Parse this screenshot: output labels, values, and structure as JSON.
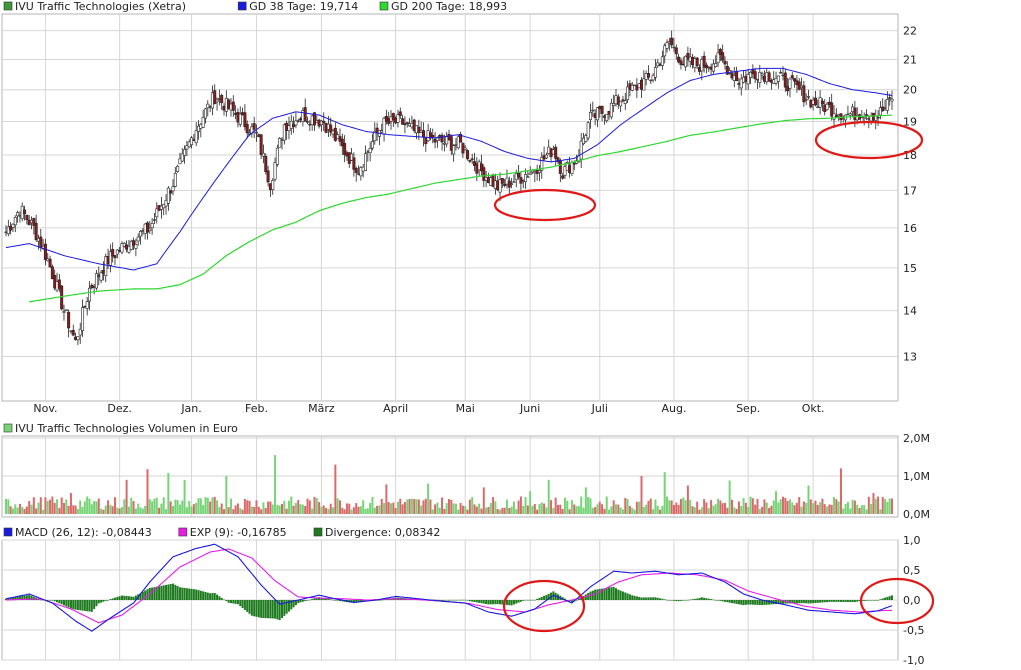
{
  "colors": {
    "grid": "#d6d6d6",
    "frame": "#b4b4b4",
    "candle_up": "#3c9a3c",
    "candle_down": "#8b1a1a",
    "gd38": "#1b1be0",
    "gd200": "#2ed82e",
    "macd": "#1b1be0",
    "exp": "#e81ee8",
    "divergence": "#1e7a1e",
    "vol_up": "#76d476",
    "vol_down": "#d86a6a",
    "highlight": "#e01818"
  },
  "chart_data": [
    {
      "type": "candlestick",
      "panel": "price",
      "legend": [
        {
          "label": "IVU Traffic Technologies (Xetra)",
          "color": "#3c9a3c"
        },
        {
          "label": "GD 38 Tage: 19,714",
          "color": "#1b1be0"
        },
        {
          "label": "GD 200 Tage: 18,993",
          "color": "#2ed82e"
        }
      ],
      "y_ticks": [
        "22",
        "21",
        "20",
        "19",
        "18",
        "17",
        "16",
        "15",
        "14",
        "13"
      ],
      "y_tick_values": [
        22,
        21,
        20,
        19,
        18,
        17,
        16,
        15,
        14,
        13
      ],
      "ylim": [
        12.1,
        22.6
      ],
      "scale": "log",
      "x_ticks": [
        "Nov.",
        "Dez.",
        "Jan.",
        "Feb.",
        "März",
        "April",
        "Mai",
        "Juni",
        "Juli",
        "Aug.",
        "Sep.",
        "Okt."
      ],
      "x_tick_index": [
        17,
        49,
        80,
        108,
        136,
        168,
        198,
        226,
        256,
        288,
        320,
        348
      ],
      "n_days": 383,
      "anchors_close": [
        [
          0,
          15.9
        ],
        [
          6,
          16.5
        ],
        [
          12,
          16.0
        ],
        [
          18,
          15.2
        ],
        [
          25,
          14.0
        ],
        [
          30,
          13.3
        ],
        [
          36,
          14.5
        ],
        [
          44,
          15.2
        ],
        [
          52,
          15.6
        ],
        [
          62,
          16.0
        ],
        [
          72,
          17.2
        ],
        [
          82,
          18.8
        ],
        [
          90,
          19.8
        ],
        [
          98,
          19.3
        ],
        [
          108,
          18.6
        ],
        [
          114,
          17.2
        ],
        [
          120,
          18.9
        ],
        [
          128,
          19.2
        ],
        [
          137,
          19.0
        ],
        [
          145,
          18.2
        ],
        [
          152,
          17.6
        ],
        [
          162,
          18.9
        ],
        [
          170,
          19.0
        ],
        [
          178,
          18.6
        ],
        [
          186,
          18.4
        ],
        [
          196,
          18.3
        ],
        [
          204,
          17.6
        ],
        [
          212,
          17.1
        ],
        [
          220,
          17.3
        ],
        [
          228,
          17.6
        ],
        [
          236,
          18.2
        ],
        [
          240,
          17.5
        ],
        [
          246,
          17.9
        ],
        [
          252,
          19.1
        ],
        [
          260,
          19.4
        ],
        [
          270,
          20.0
        ],
        [
          278,
          20.4
        ],
        [
          286,
          21.6
        ],
        [
          292,
          20.9
        ],
        [
          300,
          20.8
        ],
        [
          308,
          21.0
        ],
        [
          316,
          20.3
        ],
        [
          324,
          20.6
        ],
        [
          332,
          20.4
        ],
        [
          340,
          20.1
        ],
        [
          348,
          19.6
        ],
        [
          356,
          19.4
        ],
        [
          362,
          19.2
        ],
        [
          370,
          19.3
        ],
        [
          376,
          19.2
        ],
        [
          380,
          19.5
        ],
        [
          383,
          19.9
        ]
      ],
      "anchors_gd38": [
        [
          0,
          15.5
        ],
        [
          10,
          15.6
        ],
        [
          25,
          15.3
        ],
        [
          40,
          15.1
        ],
        [
          55,
          14.95
        ],
        [
          65,
          15.1
        ],
        [
          75,
          15.9
        ],
        [
          85,
          16.8
        ],
        [
          95,
          17.7
        ],
        [
          105,
          18.6
        ],
        [
          115,
          19.1
        ],
        [
          125,
          19.3
        ],
        [
          135,
          19.2
        ],
        [
          145,
          18.9
        ],
        [
          155,
          18.7
        ],
        [
          165,
          18.6
        ],
        [
          175,
          18.55
        ],
        [
          185,
          18.5
        ],
        [
          195,
          18.6
        ],
        [
          205,
          18.4
        ],
        [
          215,
          18.1
        ],
        [
          225,
          17.9
        ],
        [
          235,
          17.8
        ],
        [
          245,
          17.9
        ],
        [
          255,
          18.3
        ],
        [
          265,
          18.9
        ],
        [
          275,
          19.4
        ],
        [
          285,
          19.9
        ],
        [
          295,
          20.3
        ],
        [
          305,
          20.5
        ],
        [
          315,
          20.6
        ],
        [
          325,
          20.7
        ],
        [
          335,
          20.7
        ],
        [
          345,
          20.5
        ],
        [
          355,
          20.2
        ],
        [
          365,
          20.0
        ],
        [
          375,
          19.9
        ],
        [
          383,
          19.8
        ]
      ],
      "anchors_gd200": [
        [
          10,
          14.2
        ],
        [
          25,
          14.33
        ],
        [
          40,
          14.45
        ],
        [
          55,
          14.5
        ],
        [
          65,
          14.5
        ],
        [
          75,
          14.6
        ],
        [
          85,
          14.85
        ],
        [
          95,
          15.3
        ],
        [
          105,
          15.65
        ],
        [
          115,
          15.95
        ],
        [
          125,
          16.15
        ],
        [
          135,
          16.45
        ],
        [
          145,
          16.65
        ],
        [
          155,
          16.8
        ],
        [
          165,
          16.9
        ],
        [
          175,
          17.05
        ],
        [
          185,
          17.2
        ],
        [
          195,
          17.3
        ],
        [
          205,
          17.4
        ],
        [
          215,
          17.45
        ],
        [
          225,
          17.55
        ],
        [
          235,
          17.65
        ],
        [
          245,
          17.8
        ],
        [
          255,
          17.98
        ],
        [
          265,
          18.1
        ],
        [
          275,
          18.25
        ],
        [
          285,
          18.4
        ],
        [
          295,
          18.58
        ],
        [
          305,
          18.68
        ],
        [
          315,
          18.8
        ],
        [
          325,
          18.92
        ],
        [
          335,
          19.02
        ],
        [
          345,
          19.08
        ],
        [
          355,
          19.1
        ],
        [
          365,
          19.15
        ],
        [
          375,
          19.17
        ],
        [
          383,
          19.2
        ]
      ]
    },
    {
      "type": "bar",
      "panel": "volume",
      "legend": [
        {
          "label": "IVU Traffic Technologies Volumen in Euro",
          "color": "#76d476"
        }
      ],
      "y_ticks": [
        "2,0M",
        "1,0M",
        "0,0M"
      ],
      "y_tick_values": [
        2.0,
        1.0,
        0.0
      ],
      "unit": "Mio. Euro",
      "typical_volume": 0.32,
      "spikes": [
        [
          28,
          0.55
        ],
        [
          52,
          0.9
        ],
        [
          61,
          1.18
        ],
        [
          70,
          1.08
        ],
        [
          77,
          0.9
        ],
        [
          95,
          1.0
        ],
        [
          116,
          1.55
        ],
        [
          142,
          1.3
        ],
        [
          164,
          0.78
        ],
        [
          182,
          0.8
        ],
        [
          206,
          0.7
        ],
        [
          226,
          0.6
        ],
        [
          234,
          0.9
        ],
        [
          250,
          0.7
        ],
        [
          274,
          1.0
        ],
        [
          284,
          1.1
        ],
        [
          294,
          0.75
        ],
        [
          312,
          0.88
        ],
        [
          332,
          0.6
        ],
        [
          346,
          0.75
        ],
        [
          360,
          1.2
        ],
        [
          374,
          0.55
        ]
      ]
    },
    {
      "type": "line",
      "panel": "macd",
      "legend": [
        {
          "label": "MACD (26, 12): -0,08443",
          "color": "#1b1be0"
        },
        {
          "label": "EXP (9): -0,16785",
          "color": "#e81ee8"
        },
        {
          "label": "Divergence: 0,08342",
          "color": "#1e7a1e"
        }
      ],
      "y_ticks": [
        "1,0",
        "0,5",
        "0,0",
        "-0,5",
        "-1,0"
      ],
      "y_tick_values": [
        1.0,
        0.5,
        0.0,
        -0.5,
        -1.0
      ],
      "ylim": [
        -1.0,
        1.0
      ],
      "anchors_macd": [
        [
          0,
          0.02
        ],
        [
          10,
          0.1
        ],
        [
          20,
          -0.05
        ],
        [
          30,
          -0.35
        ],
        [
          37,
          -0.52
        ],
        [
          45,
          -0.3
        ],
        [
          55,
          -0.05
        ],
        [
          62,
          0.3
        ],
        [
          72,
          0.72
        ],
        [
          82,
          0.86
        ],
        [
          90,
          0.93
        ],
        [
          100,
          0.72
        ],
        [
          110,
          0.25
        ],
        [
          118,
          -0.07
        ],
        [
          126,
          0.0
        ],
        [
          135,
          0.08
        ],
        [
          142,
          0.02
        ],
        [
          150,
          -0.04
        ],
        [
          160,
          0.0
        ],
        [
          168,
          0.06
        ],
        [
          178,
          0.02
        ],
        [
          188,
          -0.02
        ],
        [
          198,
          -0.05
        ],
        [
          208,
          -0.2
        ],
        [
          218,
          -0.27
        ],
        [
          228,
          -0.15
        ],
        [
          236,
          0.08
        ],
        [
          244,
          -0.05
        ],
        [
          252,
          0.22
        ],
        [
          262,
          0.48
        ],
        [
          270,
          0.45
        ],
        [
          280,
          0.48
        ],
        [
          290,
          0.42
        ],
        [
          300,
          0.45
        ],
        [
          310,
          0.3
        ],
        [
          318,
          0.1
        ],
        [
          326,
          0.0
        ],
        [
          336,
          -0.08
        ],
        [
          346,
          -0.17
        ],
        [
          356,
          -0.2
        ],
        [
          366,
          -0.23
        ],
        [
          376,
          -0.18
        ],
        [
          383,
          -0.08
        ]
      ],
      "anchors_exp": [
        [
          0,
          0.0
        ],
        [
          15,
          0.02
        ],
        [
          28,
          -0.15
        ],
        [
          40,
          -0.38
        ],
        [
          50,
          -0.25
        ],
        [
          62,
          0.1
        ],
        [
          75,
          0.55
        ],
        [
          88,
          0.8
        ],
        [
          96,
          0.85
        ],
        [
          106,
          0.7
        ],
        [
          116,
          0.32
        ],
        [
          126,
          0.05
        ],
        [
          136,
          0.03
        ],
        [
          146,
          0.02
        ],
        [
          156,
          0.0
        ],
        [
          166,
          0.02
        ],
        [
          176,
          0.01
        ],
        [
          188,
          -0.02
        ],
        [
          200,
          -0.06
        ],
        [
          212,
          -0.16
        ],
        [
          224,
          -0.2
        ],
        [
          234,
          -0.08
        ],
        [
          244,
          0.0
        ],
        [
          254,
          0.1
        ],
        [
          264,
          0.3
        ],
        [
          274,
          0.42
        ],
        [
          286,
          0.45
        ],
        [
          298,
          0.42
        ],
        [
          310,
          0.33
        ],
        [
          320,
          0.15
        ],
        [
          332,
          0.02
        ],
        [
          344,
          -0.1
        ],
        [
          356,
          -0.17
        ],
        [
          368,
          -0.2
        ],
        [
          376,
          -0.18
        ],
        [
          383,
          -0.17
        ]
      ]
    }
  ]
}
